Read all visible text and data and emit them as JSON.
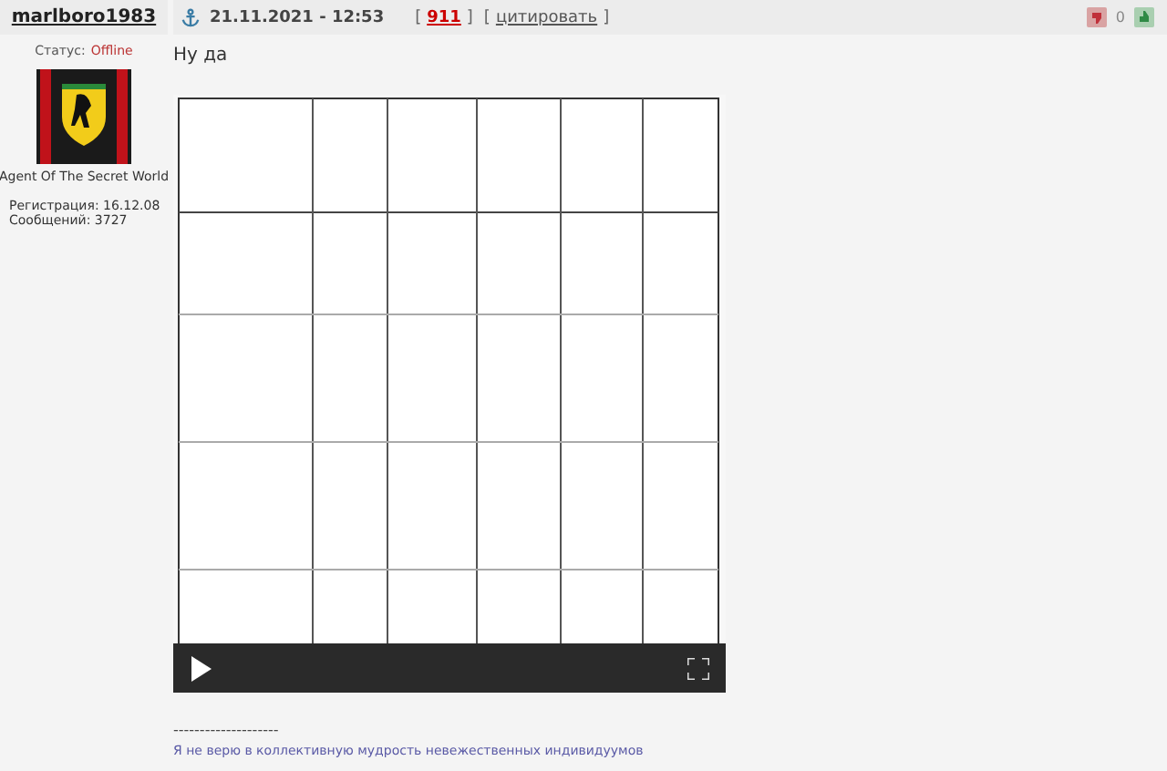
{
  "post": {
    "author": "marlboro1983",
    "status_label": "Статус:",
    "status": "Offline",
    "rank": "Agent Of The Secret World",
    "registration": "Регистрация: 16.12.08",
    "messages": "Сообщений: 3727",
    "date": "21.11.2021 - 12:53",
    "number_link": {
      "open": "[",
      "label": "911",
      "close": "]"
    },
    "quote_link": {
      "open": "[",
      "label": "цитировать",
      "close": "]"
    },
    "rating": "0",
    "text": "Ну да",
    "signature_rule": "--------------------",
    "signature": "Я не верю в коллективную мудрость невежественных индивидуумов"
  }
}
